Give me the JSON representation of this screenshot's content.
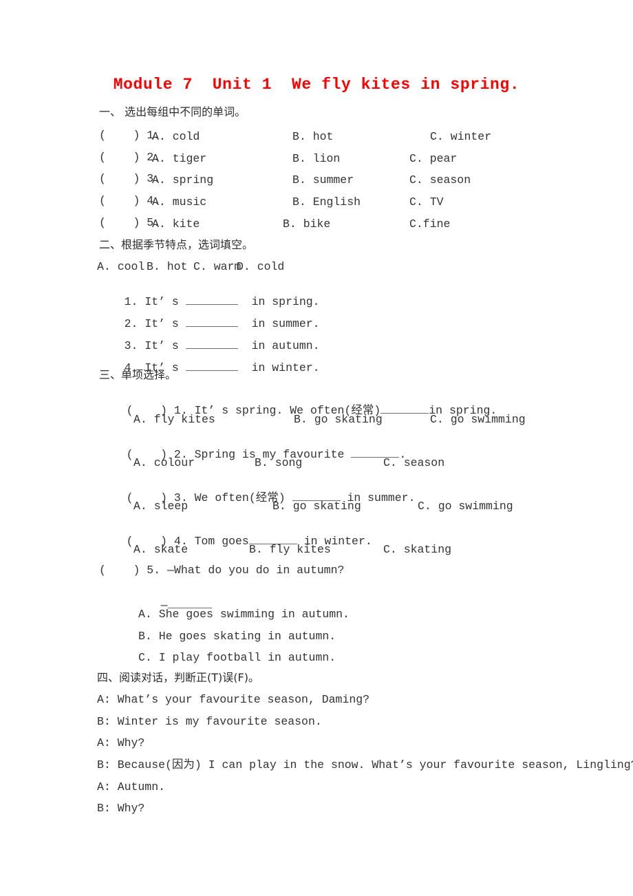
{
  "title": "Module 7  Unit 1  We fly kites in spring.",
  "title_color": "#fe0000",
  "sections": {
    "one": {
      "heading": "一、 选出每组中不同的单词。",
      "items": [
        {
          "mark": "(    ) 1.",
          "a": "A. cold",
          "b": "B. hot",
          "c": "C. winter"
        },
        {
          "mark": "(    ) 2.",
          "a": "A. tiger",
          "b": "B. lion",
          "c": "C. pear"
        },
        {
          "mark": "(    ) 3.",
          "a": "A. spring",
          "b": "B. summer",
          "c": "C. season"
        },
        {
          "mark": "(    ) 4.",
          "a": "A. music",
          "b": "B. English",
          "c": "C. TV"
        },
        {
          "mark": "(    ) 5.",
          "a": "A. kite",
          "b": "B. bike",
          "c": "C.fine"
        }
      ]
    },
    "two": {
      "heading": "二、根据季节特点，选词填空。",
      "wordbank": [
        "A. cool",
        "B. hot",
        "C. warm",
        "D. cold"
      ],
      "items": [
        {
          "num": "1.",
          "before": "It’ s",
          "after": "in spring."
        },
        {
          "num": "2.",
          "before": "It’ s",
          "after": "in summer."
        },
        {
          "num": "3.",
          "before": "It’ s",
          "after": "in autumn."
        },
        {
          "num": "4.",
          "before": "It’ s",
          "after": "in winter."
        }
      ]
    },
    "three": {
      "heading": "三、单项选择。",
      "q1": {
        "stem_pre": "(    ) 1. It’ s spring. We often(经常)",
        "stem_post": "in spring.",
        "a": "A. fly kites",
        "b": "B. go skating",
        "c": "C. go swimming"
      },
      "q2": {
        "stem_pre": "(    ) 2. Spring is my favourite ",
        "stem_post": ".",
        "a": "A. colour",
        "b": "B. song",
        "c": "C. season"
      },
      "q3": {
        "stem_pre": "(    ) 3. We often(经常) ",
        "stem_post": " in summer.",
        "a": "A. sleep",
        "b": "B. go skating",
        "c": "C. go swimming"
      },
      "q4": {
        "stem_pre": "(    ) 4. Tom goes",
        "stem_post": " in winter.",
        "a": "A. skate",
        "b": "B. fly kites",
        "c": "C. skating"
      },
      "q5": {
        "stem": "(    ) 5. —What do you do in autumn?",
        "answer_dash": "—",
        "a": "A. She goes swimming in autumn.",
        "b": "B. He goes skating in autumn.",
        "c": "C. I play football in autumn."
      }
    },
    "four": {
      "heading": "四、阅读对话，判断正(T)误(F)。",
      "dialogue": [
        "A: What’s your favourite season, Daming?",
        "B: Winter is my favourite season.",
        "A: Why?",
        "B: Because(因为) I can play in the snow. What’s your favourite season, Lingling?",
        "A: Autumn.",
        "B: Why?"
      ]
    }
  }
}
